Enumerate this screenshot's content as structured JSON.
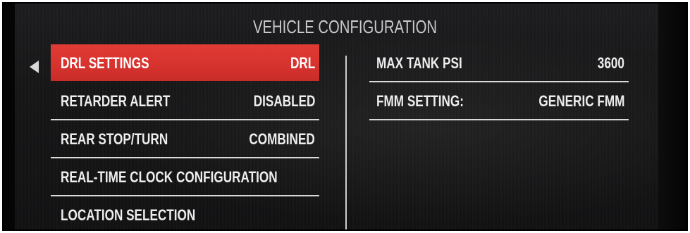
{
  "screen": {
    "title": "VEHICLE CONFIGURATION"
  },
  "left_menu": {
    "items": [
      {
        "label": "DRL SETTINGS",
        "value": "DRL",
        "selected": true
      },
      {
        "label": "RETARDER ALERT",
        "value": "DISABLED"
      },
      {
        "label": "REAR STOP/TURN",
        "value": "COMBINED"
      },
      {
        "label": "REAL-TIME CLOCK CONFIGURATION",
        "value": ""
      },
      {
        "label": "LOCATION SELECTION",
        "value": ""
      }
    ]
  },
  "right_menu": {
    "items": [
      {
        "label": "MAX TANK PSI",
        "value": "3600"
      },
      {
        "label": "FMM SETTING:",
        "value": "GENERIC FMM"
      }
    ]
  },
  "colors": {
    "selected_row": "#d6322e",
    "text": "#ededee",
    "background": "#161617",
    "rule": "#d9d9d9"
  },
  "icons": {
    "selection_pointer": "triangle-left-icon"
  }
}
